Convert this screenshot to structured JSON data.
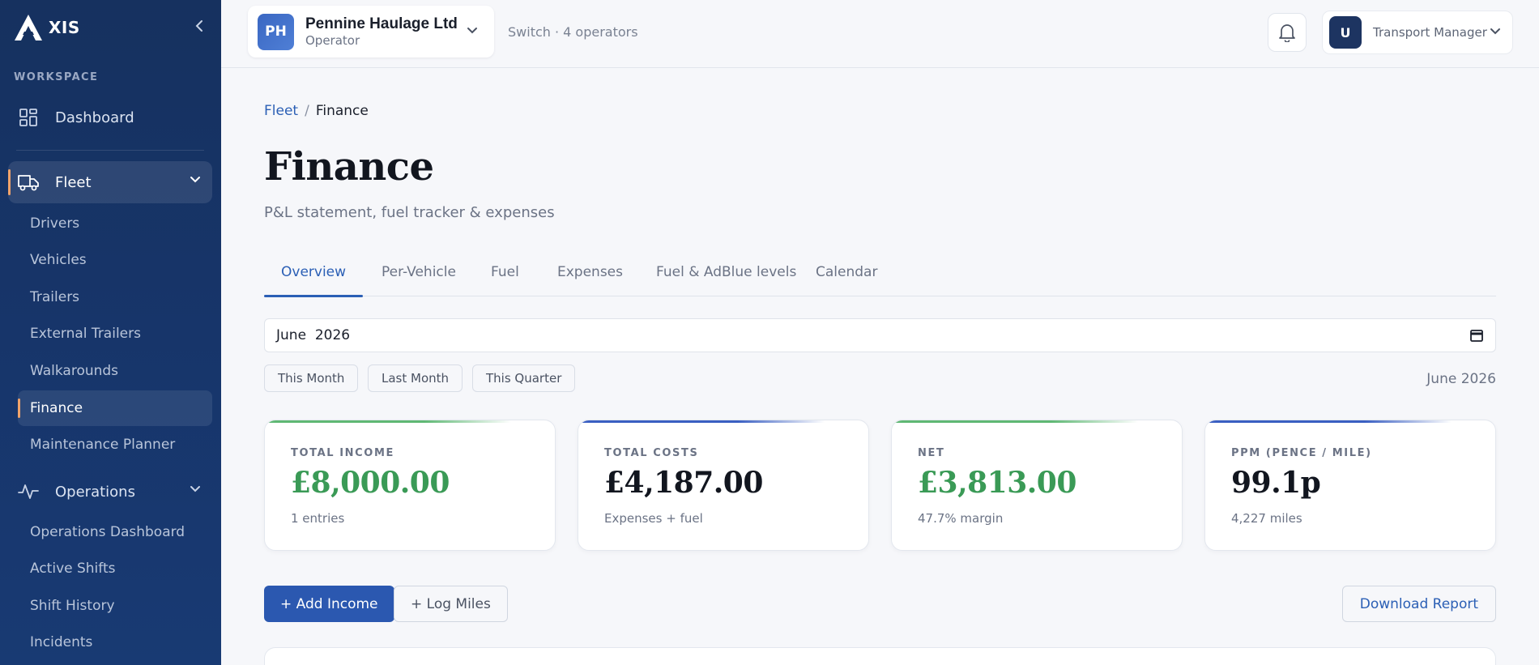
{
  "brand": {
    "name": "XIS"
  },
  "sidebar": {
    "section_label": "WORKSPACE",
    "dashboard": "Dashboard",
    "fleet": {
      "label": "Fleet",
      "items": [
        "Drivers",
        "Vehicles",
        "Trailers",
        "External Trailers",
        "Walkarounds",
        "Finance",
        "Maintenance Planner"
      ],
      "active_item": "Finance"
    },
    "operations": {
      "label": "Operations",
      "items": [
        "Operations Dashboard",
        "Active Shifts",
        "Shift History",
        "Incidents"
      ]
    }
  },
  "topbar": {
    "org": {
      "initials": "PH",
      "name": "Pennine Haulage Ltd",
      "role": "Operator"
    },
    "switch_text": "Switch · 4 operators",
    "user": {
      "initial": "U",
      "role": "Transport Manager"
    }
  },
  "breadcrumb": {
    "parent": "Fleet",
    "separator": "/",
    "current": "Finance"
  },
  "page": {
    "title": "Finance",
    "subtitle": "P&L statement, fuel tracker & expenses"
  },
  "tabs": [
    "Overview",
    "Per-Vehicle",
    "Fuel",
    "Expenses",
    "Fuel & AdBlue levels",
    "Calendar"
  ],
  "active_tab": "Overview",
  "date_filter": {
    "value": "June  2026",
    "quick": [
      "This Month",
      "Last Month",
      "This Quarter"
    ],
    "period_label": "June 2026"
  },
  "kpis": [
    {
      "label": "TOTAL INCOME",
      "value": "£8,000.00",
      "note": "1 entries",
      "value_color": "#3a9a56",
      "accent": "#5fb874"
    },
    {
      "label": "TOTAL COSTS",
      "value": "£4,187.00",
      "note": "Expenses + fuel",
      "value_color": "#12161f",
      "accent": "#3a5fc2"
    },
    {
      "label": "NET",
      "value": "£3,813.00",
      "note": "47.7% margin",
      "value_color": "#3a9a56",
      "accent": "#5fb874"
    },
    {
      "label": "PPM (PENCE / MILE)",
      "value": "99.1p",
      "note": "4,227 miles",
      "value_color": "#12161f",
      "accent": "#3a5fc2"
    }
  ],
  "actions": {
    "add_income": "+ Add Income",
    "log_miles": "+ Log Miles",
    "download_report": "Download Report"
  },
  "colors": {
    "sidebar_bg": "#16315f",
    "primary": "#2b58b0",
    "link": "#2b5fb5",
    "positive": "#3a9a56",
    "active_marker": "#f0a36b"
  }
}
